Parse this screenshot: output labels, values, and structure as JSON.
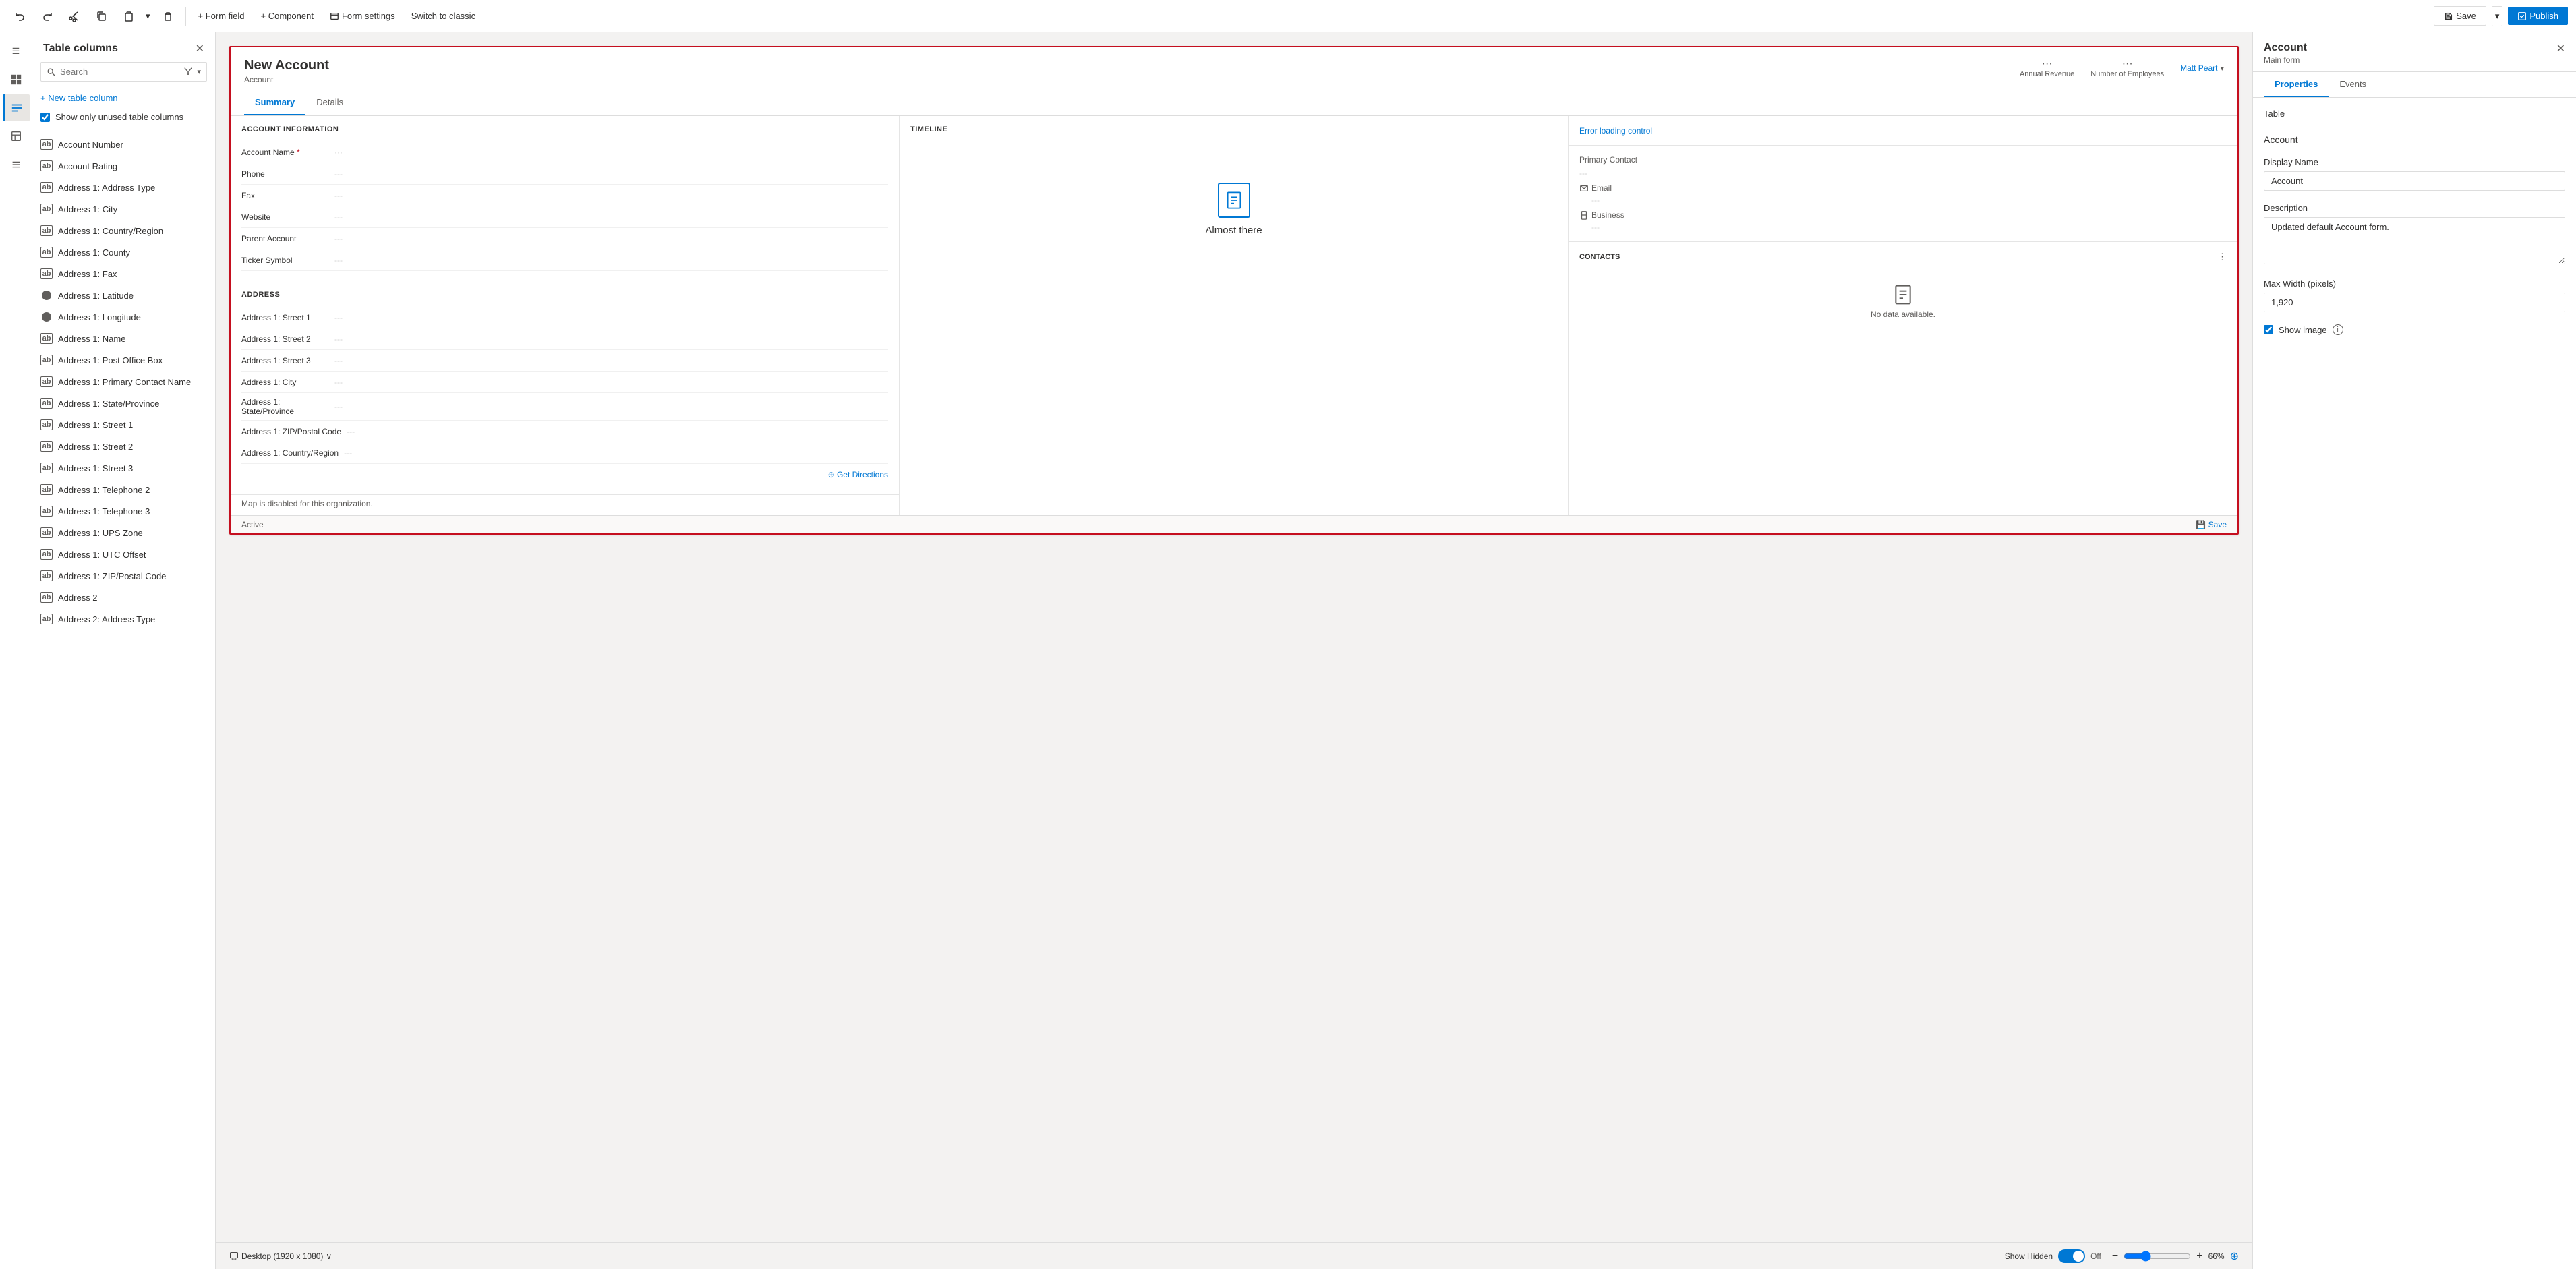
{
  "toolbar": {
    "undo_label": "↩",
    "redo_label": "↪",
    "cut_label": "✂",
    "copy_label": "⧉",
    "paste_label": "📋",
    "paste_chevron": "▾",
    "delete_label": "🗑",
    "form_field_label": "+ Form field",
    "component_label": "+ Component",
    "form_settings_label": "Form settings",
    "switch_classic_label": "Switch to classic",
    "save_label": "Save",
    "save_chevron": "▾",
    "publish_label": "Publish"
  },
  "sidebar": {
    "title": "Table columns",
    "search_placeholder": "Search",
    "new_table_btn": "+ New table column",
    "show_unused_label": "Show only unused table columns",
    "items": [
      {
        "label": "Account Number",
        "icon": "grid"
      },
      {
        "label": "Account Rating",
        "icon": "grid"
      },
      {
        "label": "Address 1: Address Type",
        "icon": "grid"
      },
      {
        "label": "Address 1: City",
        "icon": "grid"
      },
      {
        "label": "Address 1: Country/Region",
        "icon": "grid"
      },
      {
        "label": "Address 1: County",
        "icon": "grid"
      },
      {
        "label": "Address 1: Fax",
        "icon": "grid"
      },
      {
        "label": "Address 1: Latitude",
        "icon": "circle"
      },
      {
        "label": "Address 1: Longitude",
        "icon": "circle"
      },
      {
        "label": "Address 1: Name",
        "icon": "grid"
      },
      {
        "label": "Address 1: Post Office Box",
        "icon": "grid"
      },
      {
        "label": "Address 1: Primary Contact Name",
        "icon": "grid"
      },
      {
        "label": "Address 1: State/Province",
        "icon": "grid"
      },
      {
        "label": "Address 1: Street 1",
        "icon": "grid"
      },
      {
        "label": "Address 1: Street 2",
        "icon": "grid"
      },
      {
        "label": "Address 1: Street 3",
        "icon": "grid"
      },
      {
        "label": "Address 1: Telephone 2",
        "icon": "grid"
      },
      {
        "label": "Address 1: Telephone 3",
        "icon": "grid"
      },
      {
        "label": "Address 1: UPS Zone",
        "icon": "grid"
      },
      {
        "label": "Address 1: UTC Offset",
        "icon": "grid"
      },
      {
        "label": "Address 1: ZIP/Postal Code",
        "icon": "grid"
      },
      {
        "label": "Address 2",
        "icon": "grid"
      },
      {
        "label": "Address 2: Address Type",
        "icon": "grid"
      }
    ]
  },
  "form": {
    "title": "New Account",
    "subtitle": "Account",
    "header_fields": [
      {
        "label": "Annual Revenue",
        "dots": "···"
      },
      {
        "label": "Number of Employees",
        "dots": "···"
      }
    ],
    "owner": "Matt Peart",
    "tabs": [
      "Summary",
      "Details"
    ],
    "active_tab": "Summary",
    "account_info_title": "ACCOUNT INFORMATION",
    "fields_col1": [
      {
        "label": "Account Name",
        "required": true,
        "value": "···"
      },
      {
        "label": "Phone",
        "value": "---"
      },
      {
        "label": "Fax",
        "value": "---"
      },
      {
        "label": "Website",
        "value": "---"
      },
      {
        "label": "Parent Account",
        "value": "---"
      },
      {
        "label": "Ticker Symbol",
        "value": "---"
      }
    ],
    "timeline_title": "Timeline",
    "almost_there_text": "Almost there",
    "error_control_text": "Error loading control",
    "primary_contact_label": "Primary Contact",
    "email_label": "Email",
    "business_label": "Business",
    "contacts_title": "CONTACTS",
    "no_data_text": "No data available.",
    "address_title": "ADDRESS",
    "address_fields": [
      {
        "label": "Address 1: Street 1",
        "value": "---"
      },
      {
        "label": "Address 1: Street 2",
        "value": "---"
      },
      {
        "label": "Address 1: Street 3",
        "value": "---"
      },
      {
        "label": "Address 1: City",
        "value": "---"
      },
      {
        "label": "Address 1: State/Province",
        "value": "---"
      },
      {
        "label": "Address 1: ZIP/Postal Code",
        "value": "---"
      },
      {
        "label": "Address 1: Country/Region",
        "value": "---"
      }
    ],
    "get_directions_label": "⊕ Get Directions",
    "map_disabled_text": "Map is disabled for this organization.",
    "status_text": "Active",
    "footer_save": "💾 Save"
  },
  "status_bar": {
    "desktop_label": "Desktop (1920 x 1080)",
    "chevron": "∨",
    "show_hidden_label": "Show Hidden",
    "toggle_state": "Off",
    "zoom_level": "66%",
    "fit_icon": "⊕"
  },
  "right_panel": {
    "title": "Account",
    "subtitle": "Main form",
    "tabs": [
      "Properties",
      "Events"
    ],
    "active_tab": "Properties",
    "table_label": "Table",
    "table_value": "Account",
    "display_name_label": "Display Name",
    "display_name_value": "Account",
    "description_label": "Description",
    "description_value": "Updated default Account form.",
    "max_width_label": "Max Width (pixels)",
    "max_width_value": "1,920",
    "show_image_label": "Show image",
    "show_image_checked": true
  },
  "nav_icons": [
    {
      "name": "menu",
      "symbol": "☰"
    },
    {
      "name": "grid",
      "symbol": "⊞"
    },
    {
      "name": "active-item",
      "symbol": "≡"
    },
    {
      "name": "layers",
      "symbol": "◫"
    },
    {
      "name": "list",
      "symbol": "≣"
    }
  ]
}
